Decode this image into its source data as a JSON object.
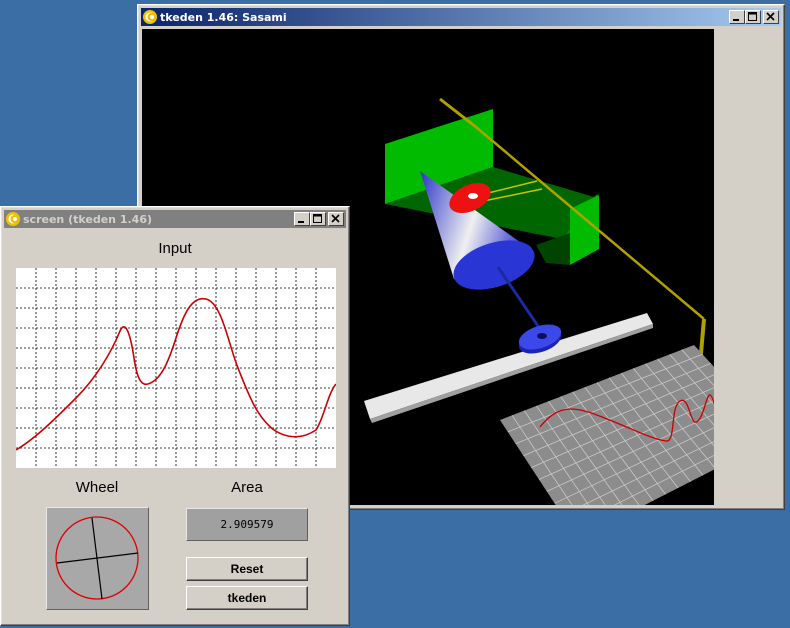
{
  "sasami_window": {
    "title": "tkeden 1.46: Sasami"
  },
  "screen_window": {
    "title": "screen (tkeden 1.46)",
    "input_label": "Input",
    "wheel_label": "Wheel",
    "area_label": "Area",
    "area_value": "2.909579",
    "reset_label": "Reset",
    "tkeden_label": "tkeden"
  },
  "colors": {
    "desktop": "#3a6ea5",
    "curve": "#cc0000",
    "titlebar_active": "#0a246a",
    "titlebar_inactive": "#808080"
  }
}
